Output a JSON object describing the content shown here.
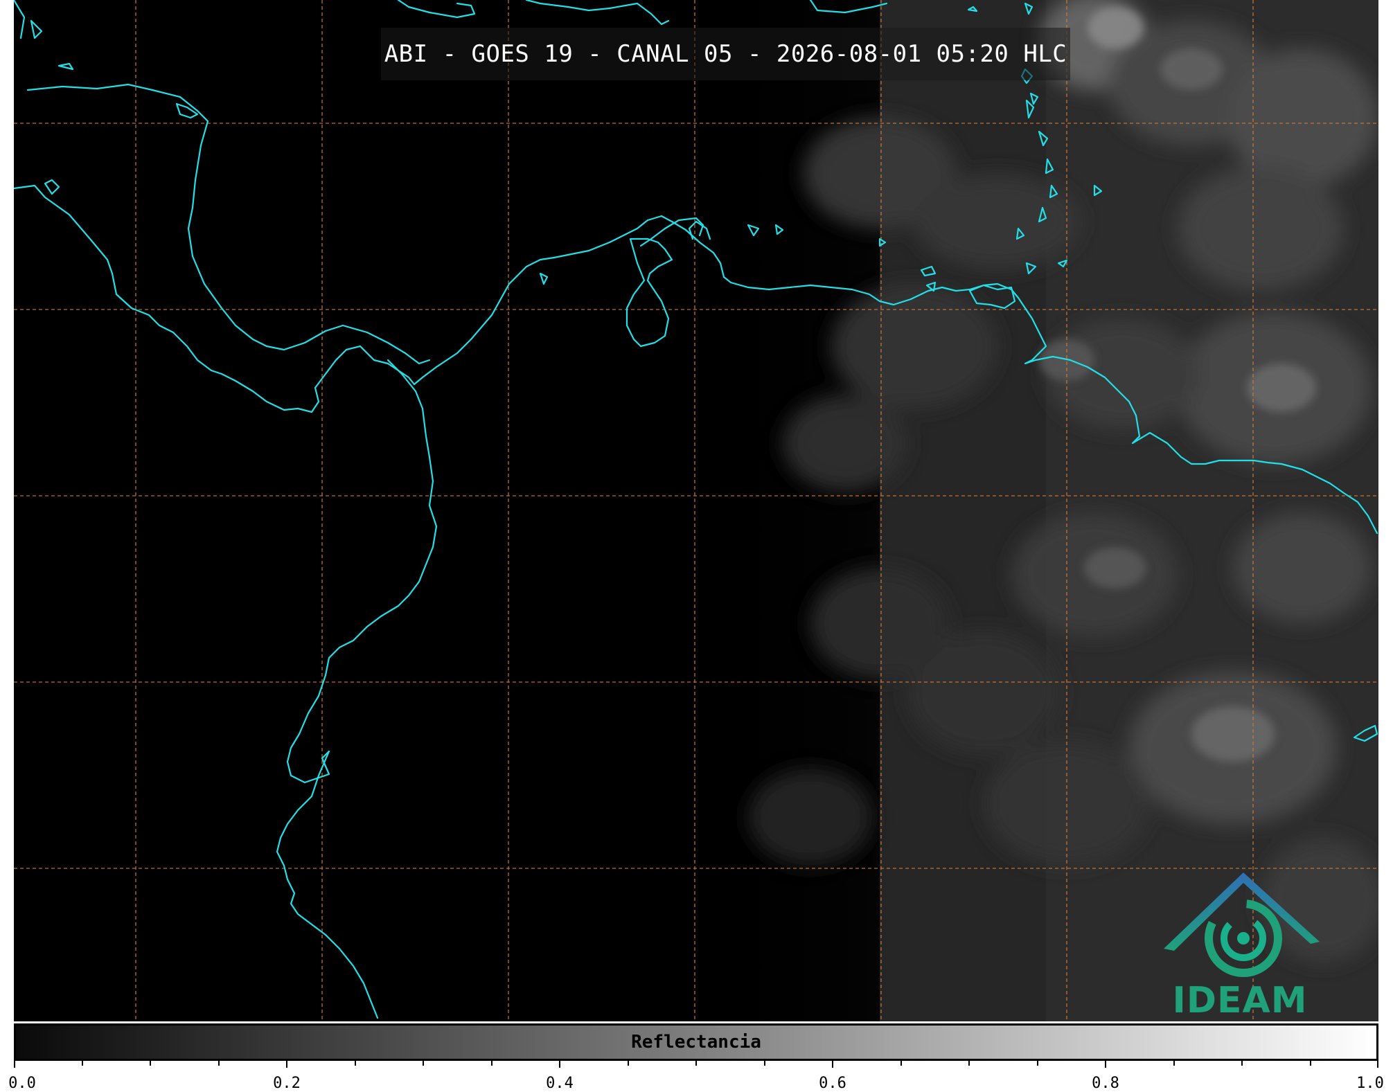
{
  "title": "ABI - GOES 19 - CANAL 05 - 2026-08-01 05:20 HLC",
  "colors": {
    "coastline": "#22e0e8",
    "grid": "#d07a3a",
    "background": "#000000",
    "logo_blue": "#2f6fb6",
    "logo_teal": "#1fa27a"
  },
  "map": {
    "coastline_icon": "coastline-outline",
    "gridlines": "dashed",
    "imagery": "cloud-reflectance-grayscale"
  },
  "logo": {
    "name": "ideam-logo",
    "text": "IDEAM"
  },
  "colorbar": {
    "label": "Reflectancia",
    "min": 0.0,
    "max": 1.0,
    "tick_labels": [
      "0.0",
      "0.2",
      "0.4",
      "0.6",
      "0.8",
      "1.0"
    ],
    "tick_values": [
      0.0,
      0.2,
      0.4,
      0.6,
      0.8,
      1.0
    ],
    "minor_step": 0.05
  }
}
